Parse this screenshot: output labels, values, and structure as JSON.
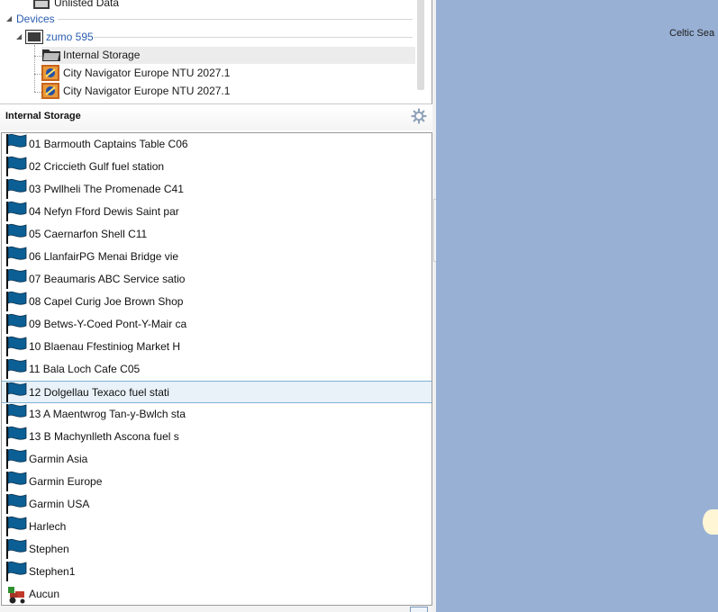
{
  "tree": {
    "unlisted": "Unlisted Data",
    "devices": "Devices",
    "device": "zumo 595",
    "internal_storage": "Internal Storage",
    "maps": [
      "City Navigator Europe NTU 2027.1",
      "City Navigator Europe NTU 2027.1"
    ]
  },
  "panel": {
    "title": "Internal Storage"
  },
  "list": {
    "items": [
      "01 Barmouth Captains Table C06",
      "02 Criccieth Gulf fuel station",
      "03 Pwllheli The Promenade C41",
      "04 Nefyn Fford Dewis Saint par",
      "05 Caernarfon Shell C11",
      "06 LlanfairPG Menai Bridge vie",
      "07 Beaumaris ABC Service satio",
      "08 Capel Curig Joe Brown Shop",
      "09 Betws-Y-Coed Pont-Y-Mair ca",
      "10 Blaenau Ffestiniog Market H",
      "11 Bala Loch Cafe C05",
      "12 Dolgellau Texaco fuel stati",
      "13 A Maentwrog Tan-y-Bwlch sta",
      "13 B Machynlleth Ascona fuel s",
      "Garmin Asia",
      "Garmin Europe",
      "Garmin USA",
      "Harlech",
      "Stephen",
      "Stephen1",
      "Aucun"
    ],
    "selected_index": 11
  },
  "map": {
    "sea_label": "Celtic Sea"
  },
  "colors": {
    "flag": "#0b5f94",
    "map_sea": "#98b0d4",
    "selection_border": "#7fb2d4",
    "devices_text": "#2a5db0"
  },
  "icons": {
    "route": "tractor-route-icon",
    "waypoint": "blue-flag-icon",
    "settings": "gear-icon"
  }
}
